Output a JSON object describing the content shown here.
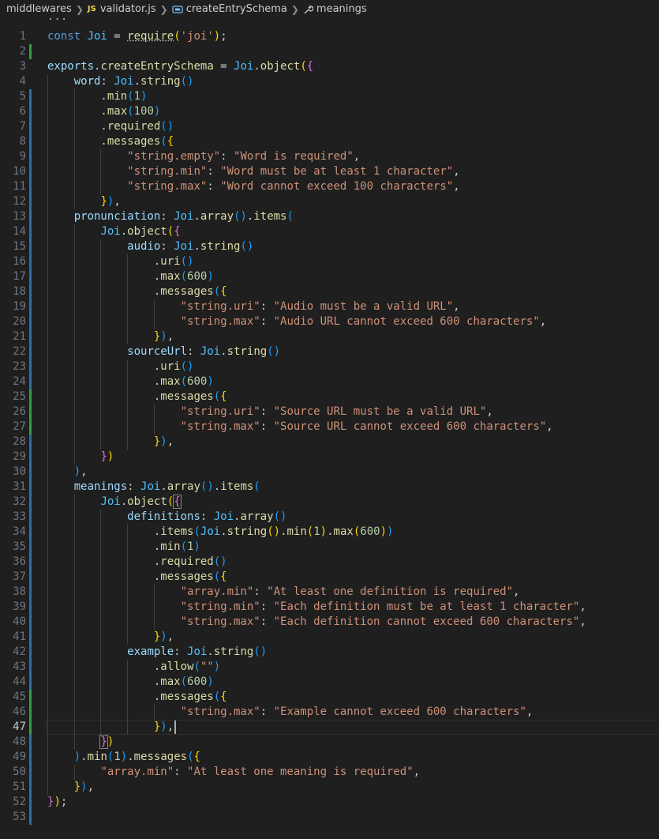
{
  "breadcrumb": {
    "folder": "middlewares",
    "file": "validator.js",
    "file_badge": "JS",
    "symbol1": "createEntrySchema",
    "symbol2": "meanings"
  },
  "fold_hint": "···",
  "active_line": 47,
  "lines": [
    {
      "n": 1,
      "g": "",
      "t": [
        [
          "kw",
          "const "
        ],
        [
          "const",
          "Joi"
        ],
        [
          "pun",
          " = "
        ],
        [
          "fn",
          "require"
        ],
        [
          "b1",
          "("
        ],
        [
          "str",
          "'joi'"
        ],
        [
          "b1",
          ")"
        ],
        [
          "pun",
          ";"
        ]
      ]
    },
    {
      "n": 2,
      "g": "add",
      "t": []
    },
    {
      "n": 3,
      "g": "",
      "t": [
        [
          "var",
          "exports"
        ],
        [
          "pun",
          "."
        ],
        [
          "fn",
          "createEntrySchema"
        ],
        [
          "pun",
          " = "
        ],
        [
          "const",
          "Joi"
        ],
        [
          "pun",
          "."
        ],
        [
          "fn",
          "object"
        ],
        [
          "b1",
          "("
        ],
        [
          "b2",
          "{"
        ]
      ]
    },
    {
      "n": 4,
      "g": "",
      "t": [
        [
          "pun",
          "    "
        ],
        [
          "prop",
          "word"
        ],
        [
          "pun",
          ": "
        ],
        [
          "const",
          "Joi"
        ],
        [
          "pun",
          "."
        ],
        [
          "fn",
          "string"
        ],
        [
          "b3",
          "()"
        ]
      ]
    },
    {
      "n": 5,
      "g": "mod",
      "t": [
        [
          "pun",
          "        ."
        ],
        [
          "fn",
          "min"
        ],
        [
          "b3",
          "("
        ],
        [
          "num",
          "1"
        ],
        [
          "b3",
          ")"
        ]
      ]
    },
    {
      "n": 6,
      "g": "mod",
      "t": [
        [
          "pun",
          "        ."
        ],
        [
          "fn",
          "max"
        ],
        [
          "b3",
          "("
        ],
        [
          "num",
          "100"
        ],
        [
          "b3",
          ")"
        ]
      ]
    },
    {
      "n": 7,
      "g": "mod",
      "t": [
        [
          "pun",
          "        ."
        ],
        [
          "fn",
          "required"
        ],
        [
          "b3",
          "()"
        ]
      ]
    },
    {
      "n": 8,
      "g": "mod",
      "t": [
        [
          "pun",
          "        ."
        ],
        [
          "fn",
          "messages"
        ],
        [
          "b3",
          "("
        ],
        [
          "b1",
          "{"
        ]
      ]
    },
    {
      "n": 9,
      "g": "mod",
      "t": [
        [
          "pun",
          "            "
        ],
        [
          "str",
          "\"string.empty\""
        ],
        [
          "pun",
          ": "
        ],
        [
          "str",
          "\"Word is required\""
        ],
        [
          "pun",
          ","
        ]
      ]
    },
    {
      "n": 10,
      "g": "mod",
      "t": [
        [
          "pun",
          "            "
        ],
        [
          "str",
          "\"string.min\""
        ],
        [
          "pun",
          ": "
        ],
        [
          "str",
          "\"Word must be at least 1 character\""
        ],
        [
          "pun",
          ","
        ]
      ]
    },
    {
      "n": 11,
      "g": "mod",
      "t": [
        [
          "pun",
          "            "
        ],
        [
          "str",
          "\"string.max\""
        ],
        [
          "pun",
          ": "
        ],
        [
          "str",
          "\"Word cannot exceed 100 characters\""
        ],
        [
          "pun",
          ","
        ]
      ]
    },
    {
      "n": 12,
      "g": "mod",
      "t": [
        [
          "pun",
          "        "
        ],
        [
          "b1",
          "}"
        ],
        [
          "b3",
          ")"
        ],
        [
          "pun",
          ","
        ]
      ]
    },
    {
      "n": 13,
      "g": "mod",
      "t": [
        [
          "pun",
          "    "
        ],
        [
          "prop",
          "pronunciation"
        ],
        [
          "pun",
          ": "
        ],
        [
          "const",
          "Joi"
        ],
        [
          "pun",
          "."
        ],
        [
          "fn",
          "array"
        ],
        [
          "b3",
          "()"
        ],
        [
          "pun",
          "."
        ],
        [
          "fn",
          "items"
        ],
        [
          "b3",
          "("
        ]
      ]
    },
    {
      "n": 14,
      "g": "mod",
      "t": [
        [
          "pun",
          "        "
        ],
        [
          "const",
          "Joi"
        ],
        [
          "pun",
          "."
        ],
        [
          "fn",
          "object"
        ],
        [
          "b1",
          "("
        ],
        [
          "b2",
          "{"
        ]
      ]
    },
    {
      "n": 15,
      "g": "mod",
      "t": [
        [
          "pun",
          "            "
        ],
        [
          "prop",
          "audio"
        ],
        [
          "pun",
          ": "
        ],
        [
          "const",
          "Joi"
        ],
        [
          "pun",
          "."
        ],
        [
          "fn",
          "string"
        ],
        [
          "b3",
          "()"
        ]
      ]
    },
    {
      "n": 16,
      "g": "mod",
      "t": [
        [
          "pun",
          "                ."
        ],
        [
          "fn",
          "uri"
        ],
        [
          "b3",
          "()"
        ]
      ]
    },
    {
      "n": 17,
      "g": "mod",
      "t": [
        [
          "pun",
          "                ."
        ],
        [
          "fn",
          "max"
        ],
        [
          "b3",
          "("
        ],
        [
          "num",
          "600"
        ],
        [
          "b3",
          ")"
        ]
      ]
    },
    {
      "n": 18,
      "g": "mod",
      "t": [
        [
          "pun",
          "                ."
        ],
        [
          "fn",
          "messages"
        ],
        [
          "b3",
          "("
        ],
        [
          "b1",
          "{"
        ]
      ]
    },
    {
      "n": 19,
      "g": "mod",
      "t": [
        [
          "pun",
          "                    "
        ],
        [
          "str",
          "\"string.uri\""
        ],
        [
          "pun",
          ": "
        ],
        [
          "str",
          "\"Audio must be a valid URL\""
        ],
        [
          "pun",
          ","
        ]
      ]
    },
    {
      "n": 20,
      "g": "mod",
      "t": [
        [
          "pun",
          "                    "
        ],
        [
          "str",
          "\"string.max\""
        ],
        [
          "pun",
          ": "
        ],
        [
          "str",
          "\"Audio URL cannot exceed 600 characters\""
        ],
        [
          "pun",
          ","
        ]
      ]
    },
    {
      "n": 21,
      "g": "mod",
      "t": [
        [
          "pun",
          "                "
        ],
        [
          "b1",
          "}"
        ],
        [
          "b3",
          ")"
        ],
        [
          "pun",
          ","
        ]
      ]
    },
    {
      "n": 22,
      "g": "mod",
      "t": [
        [
          "pun",
          "            "
        ],
        [
          "prop",
          "sourceUrl"
        ],
        [
          "pun",
          ": "
        ],
        [
          "const",
          "Joi"
        ],
        [
          "pun",
          "."
        ],
        [
          "fn",
          "string"
        ],
        [
          "b3",
          "()"
        ]
      ]
    },
    {
      "n": 23,
      "g": "mod",
      "t": [
        [
          "pun",
          "                ."
        ],
        [
          "fn",
          "uri"
        ],
        [
          "b3",
          "()"
        ]
      ]
    },
    {
      "n": 24,
      "g": "mod",
      "t": [
        [
          "pun",
          "                ."
        ],
        [
          "fn",
          "max"
        ],
        [
          "b3",
          "("
        ],
        [
          "num",
          "600"
        ],
        [
          "b3",
          ")"
        ]
      ]
    },
    {
      "n": 25,
      "g": "add",
      "t": [
        [
          "pun",
          "                ."
        ],
        [
          "fn",
          "messages"
        ],
        [
          "b3",
          "("
        ],
        [
          "b1",
          "{"
        ]
      ]
    },
    {
      "n": 26,
      "g": "add",
      "t": [
        [
          "pun",
          "                    "
        ],
        [
          "str",
          "\"string.uri\""
        ],
        [
          "pun",
          ": "
        ],
        [
          "str",
          "\"Source URL must be a valid URL\""
        ],
        [
          "pun",
          ","
        ]
      ]
    },
    {
      "n": 27,
      "g": "add",
      "t": [
        [
          "pun",
          "                    "
        ],
        [
          "str",
          "\"string.max\""
        ],
        [
          "pun",
          ": "
        ],
        [
          "str",
          "\"Source URL cannot exceed 600 characters\""
        ],
        [
          "pun",
          ","
        ]
      ]
    },
    {
      "n": 28,
      "g": "mod",
      "t": [
        [
          "pun",
          "                "
        ],
        [
          "b1",
          "}"
        ],
        [
          "b3",
          ")"
        ],
        [
          "pun",
          ","
        ]
      ]
    },
    {
      "n": 29,
      "g": "mod",
      "t": [
        [
          "pun",
          "        "
        ],
        [
          "b2",
          "}"
        ],
        [
          "b1",
          ")"
        ]
      ]
    },
    {
      "n": 30,
      "g": "mod",
      "t": [
        [
          "pun",
          "    "
        ],
        [
          "b3",
          ")"
        ],
        [
          "pun",
          ","
        ]
      ]
    },
    {
      "n": 31,
      "g": "mod",
      "t": [
        [
          "pun",
          "    "
        ],
        [
          "prop",
          "meanings"
        ],
        [
          "pun",
          ": "
        ],
        [
          "const",
          "Joi"
        ],
        [
          "pun",
          "."
        ],
        [
          "fn",
          "array"
        ],
        [
          "b3",
          "()"
        ],
        [
          "pun",
          "."
        ],
        [
          "fn",
          "items"
        ],
        [
          "b3",
          "("
        ]
      ]
    },
    {
      "n": 32,
      "g": "mod",
      "t": [
        [
          "pun",
          "        "
        ],
        [
          "const",
          "Joi"
        ],
        [
          "pun",
          "."
        ],
        [
          "fn",
          "object"
        ],
        [
          "b1",
          "("
        ],
        [
          "b2m",
          "{"
        ]
      ]
    },
    {
      "n": 33,
      "g": "mod",
      "t": [
        [
          "pun",
          "            "
        ],
        [
          "prop",
          "definitions"
        ],
        [
          "pun",
          ": "
        ],
        [
          "const",
          "Joi"
        ],
        [
          "pun",
          "."
        ],
        [
          "fn",
          "array"
        ],
        [
          "b3",
          "()"
        ]
      ]
    },
    {
      "n": 34,
      "g": "mod",
      "t": [
        [
          "pun",
          "                ."
        ],
        [
          "fn",
          "items"
        ],
        [
          "b3",
          "("
        ],
        [
          "const",
          "Joi"
        ],
        [
          "pun",
          "."
        ],
        [
          "fn",
          "string"
        ],
        [
          "b1",
          "()"
        ],
        [
          "pun",
          "."
        ],
        [
          "fn",
          "min"
        ],
        [
          "b1",
          "("
        ],
        [
          "num",
          "1"
        ],
        [
          "b1",
          ")"
        ],
        [
          "pun",
          "."
        ],
        [
          "fn",
          "max"
        ],
        [
          "b1",
          "("
        ],
        [
          "num",
          "600"
        ],
        [
          "b1",
          ")"
        ],
        [
          "b3",
          ")"
        ]
      ]
    },
    {
      "n": 35,
      "g": "mod",
      "t": [
        [
          "pun",
          "                ."
        ],
        [
          "fn",
          "min"
        ],
        [
          "b3",
          "("
        ],
        [
          "num",
          "1"
        ],
        [
          "b3",
          ")"
        ]
      ]
    },
    {
      "n": 36,
      "g": "mod",
      "t": [
        [
          "pun",
          "                ."
        ],
        [
          "fn",
          "required"
        ],
        [
          "b3",
          "()"
        ]
      ]
    },
    {
      "n": 37,
      "g": "mod",
      "t": [
        [
          "pun",
          "                ."
        ],
        [
          "fn",
          "messages"
        ],
        [
          "b3",
          "("
        ],
        [
          "b1",
          "{"
        ]
      ]
    },
    {
      "n": 38,
      "g": "mod",
      "t": [
        [
          "pun",
          "                    "
        ],
        [
          "str",
          "\"array.min\""
        ],
        [
          "pun",
          ": "
        ],
        [
          "str",
          "\"At least one definition is required\""
        ],
        [
          "pun",
          ","
        ]
      ]
    },
    {
      "n": 39,
      "g": "mod",
      "t": [
        [
          "pun",
          "                    "
        ],
        [
          "str",
          "\"string.min\""
        ],
        [
          "pun",
          ": "
        ],
        [
          "str",
          "\"Each definition must be at least 1 character\""
        ],
        [
          "pun",
          ","
        ]
      ]
    },
    {
      "n": 40,
      "g": "mod",
      "t": [
        [
          "pun",
          "                    "
        ],
        [
          "str",
          "\"string.max\""
        ],
        [
          "pun",
          ": "
        ],
        [
          "str",
          "\"Each definition cannot exceed 600 characters\""
        ],
        [
          "pun",
          ","
        ]
      ]
    },
    {
      "n": 41,
      "g": "mod",
      "t": [
        [
          "pun",
          "                "
        ],
        [
          "b1",
          "}"
        ],
        [
          "b3",
          ")"
        ],
        [
          "pun",
          ","
        ]
      ]
    },
    {
      "n": 42,
      "g": "mod",
      "t": [
        [
          "pun",
          "            "
        ],
        [
          "prop",
          "example"
        ],
        [
          "pun",
          ": "
        ],
        [
          "const",
          "Joi"
        ],
        [
          "pun",
          "."
        ],
        [
          "fn",
          "string"
        ],
        [
          "b3",
          "()"
        ]
      ]
    },
    {
      "n": 43,
      "g": "mod",
      "t": [
        [
          "pun",
          "                ."
        ],
        [
          "fn",
          "allow"
        ],
        [
          "b3",
          "("
        ],
        [
          "str",
          "\"\""
        ],
        [
          "b3",
          ")"
        ]
      ]
    },
    {
      "n": 44,
      "g": "mod",
      "t": [
        [
          "pun",
          "                ."
        ],
        [
          "fn",
          "max"
        ],
        [
          "b3",
          "("
        ],
        [
          "num",
          "600"
        ],
        [
          "b3",
          ")"
        ]
      ]
    },
    {
      "n": 45,
      "g": "add",
      "t": [
        [
          "pun",
          "                ."
        ],
        [
          "fn",
          "messages"
        ],
        [
          "b3",
          "("
        ],
        [
          "b1",
          "{"
        ]
      ]
    },
    {
      "n": 46,
      "g": "add",
      "t": [
        [
          "pun",
          "                    "
        ],
        [
          "str",
          "\"string.max\""
        ],
        [
          "pun",
          ": "
        ],
        [
          "str",
          "\"Example cannot exceed 600 characters\""
        ],
        [
          "pun",
          ","
        ]
      ]
    },
    {
      "n": 47,
      "g": "add",
      "t": [
        [
          "pun",
          "                "
        ],
        [
          "b1",
          "}"
        ],
        [
          "b3",
          ")"
        ],
        [
          "pun",
          ","
        ]
      ]
    },
    {
      "n": 48,
      "g": "mod",
      "t": [
        [
          "pun",
          "        "
        ],
        [
          "b2m",
          "}"
        ],
        [
          "b1",
          ")"
        ]
      ]
    },
    {
      "n": 49,
      "g": "mod",
      "t": [
        [
          "pun",
          "    "
        ],
        [
          "b3",
          ")"
        ],
        [
          "pun",
          "."
        ],
        [
          "fn",
          "min"
        ],
        [
          "b3",
          "("
        ],
        [
          "num",
          "1"
        ],
        [
          "b3",
          ")"
        ],
        [
          "pun",
          "."
        ],
        [
          "fn",
          "messages"
        ],
        [
          "b3",
          "("
        ],
        [
          "b1",
          "{"
        ]
      ]
    },
    {
      "n": 50,
      "g": "mod",
      "t": [
        [
          "pun",
          "        "
        ],
        [
          "str",
          "\"array.min\""
        ],
        [
          "pun",
          ": "
        ],
        [
          "str",
          "\"At least one meaning is required\""
        ],
        [
          "pun",
          ","
        ]
      ]
    },
    {
      "n": 51,
      "g": "mod",
      "t": [
        [
          "pun",
          "    "
        ],
        [
          "b1",
          "}"
        ],
        [
          "b3",
          ")"
        ],
        [
          "pun",
          ","
        ]
      ]
    },
    {
      "n": 52,
      "g": "mod",
      "t": [
        [
          "b2",
          "}"
        ],
        [
          "b1",
          ")"
        ],
        [
          "pun",
          ";"
        ]
      ]
    },
    {
      "n": 53,
      "g": "mod",
      "t": []
    }
  ]
}
